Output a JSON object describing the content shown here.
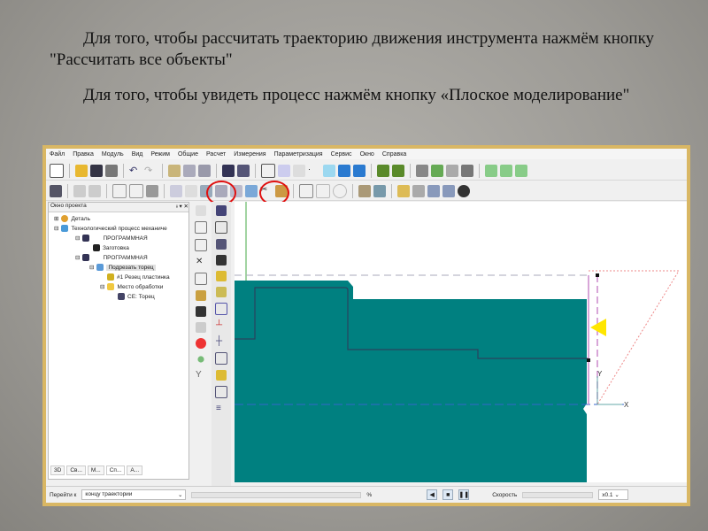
{
  "text": {
    "paragraph1": "Для того, чтобы рассчитать траекторию движения инструмента нажмём кнопку \"Рассчитать все объекты\"",
    "paragraph2": "Для того, чтобы увидеть процесс  нажмём кнопку «Плоское моделирование\""
  },
  "menu": [
    "Файл",
    "Правка",
    "Модуль",
    "Вид",
    "Режим",
    "Общие",
    "Расчет",
    "Измерения",
    "Параметризация",
    "Сервис",
    "Окно",
    "Справка"
  ],
  "project": {
    "title": "Окно проекта",
    "title_controls": "ᵻ ▾ ✕",
    "tree": [
      "Деталь",
      "Технологический процесс механиче",
      "ПРОГРАММНАЯ",
      "Заготовка",
      "ПРОГРАММНАЯ",
      "Подрезать торец",
      "#1 Резец пластинка",
      "Место обработки",
      "СЕ: Торец"
    ],
    "tabs": [
      "3D",
      "Св...",
      "М...",
      "Сп...",
      "А..."
    ]
  },
  "canvas": {
    "axis_x": "X",
    "axis_y": "Y"
  },
  "status": {
    "goto_label": "Перейти к",
    "goto_value": "концу траектории",
    "percent": "%",
    "speed_label": "Скорость",
    "speed_value": "x0.1"
  },
  "colors": {
    "stock": "#008080",
    "highlight": "#e01010",
    "frame": "#d9b764"
  }
}
